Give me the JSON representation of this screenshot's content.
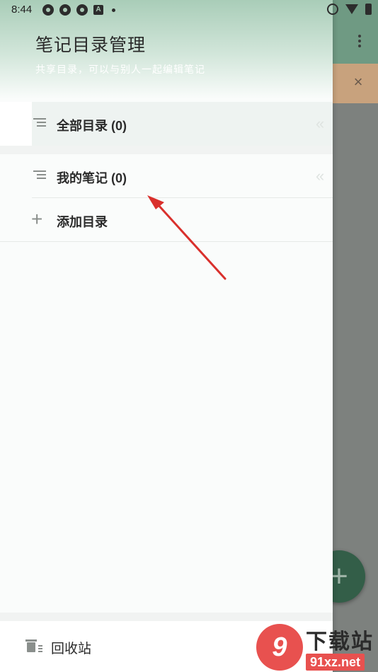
{
  "status_bar": {
    "time": "8:44",
    "notification_letter": "A"
  },
  "drawer": {
    "title": "笔记目录管理",
    "subtitle": "共享目录，可以与别人一起编辑笔记",
    "items": [
      {
        "label": "全部目录 (0)",
        "icon": "list-icon",
        "selected": true
      },
      {
        "label": "我的笔记 (0)",
        "icon": "list-icon",
        "selected": false
      }
    ],
    "add_label": "添加目录",
    "footer_label": "回收站"
  },
  "background": {
    "close_glyph": "×",
    "fab_glyph": "+"
  },
  "watermark": {
    "logo_text": "9",
    "top_text": "下载站",
    "bottom_text": "91xz.net"
  },
  "colors": {
    "accent": "#6f9a83",
    "arrow": "#d9302c",
    "watermark_red": "#e8514f"
  }
}
